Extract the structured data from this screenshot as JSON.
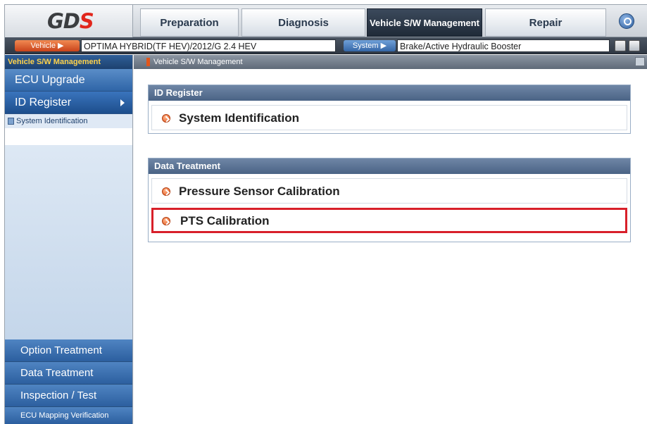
{
  "brand": {
    "logo_text": "GD",
    "logo_accent": "S"
  },
  "nav": {
    "tabs": [
      {
        "label": "Preparation",
        "active": false
      },
      {
        "label": "Diagnosis",
        "active": false
      },
      {
        "label": "Vehicle S/W Management",
        "active": true
      },
      {
        "label": "Repair",
        "active": false
      }
    ]
  },
  "vehicle_bar": {
    "vehicle_button": "Vehicle ▶",
    "vehicle_value": "OPTIMA HYBRID(TF HEV)/2012/G 2.4 HEV",
    "system_button": "System ▶",
    "system_value": "Brake/Active Hydraulic Booster"
  },
  "sidebar": {
    "header": "Vehicle S/W Management",
    "top_items": [
      {
        "label": "ECU Upgrade",
        "active": false
      },
      {
        "label": "ID Register",
        "active": true
      }
    ],
    "sub_items": [
      {
        "label": "System Identification"
      }
    ],
    "bottom_items": [
      {
        "label": "Option Treatment"
      },
      {
        "label": "Data Treatment"
      },
      {
        "label": "Inspection / Test"
      },
      {
        "label": "ECU Mapping Verification"
      }
    ]
  },
  "main": {
    "breadcrumb": "Vehicle S/W Management",
    "panels": [
      {
        "title": "ID Register",
        "items": [
          {
            "label": "System Identification",
            "selected": false
          }
        ]
      },
      {
        "title": "Data Treatment",
        "items": [
          {
            "label": "Pressure Sensor Calibration",
            "selected": false
          },
          {
            "label": "PTS Calibration",
            "selected": true
          }
        ]
      }
    ]
  },
  "colors": {
    "accent_red": "#d8202a",
    "nav_active": "#1f2a38",
    "sidebar_blue": "#2f65a7",
    "bullet_orange": "#e0561c"
  }
}
